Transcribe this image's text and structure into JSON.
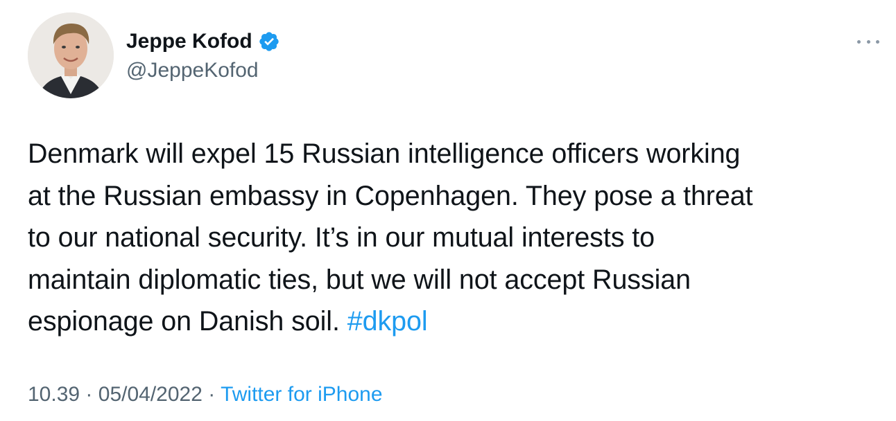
{
  "author": {
    "display_name": "Jeppe Kofod",
    "handle": "@JeppeKofod",
    "verified": true,
    "verified_icon": "verified-badge-icon"
  },
  "tweet": {
    "lines": [
      "Denmark will expel 15 Russian intelligence officers working",
      "at the Russian embassy in Copenhagen. They pose a threat",
      "to our national security. It’s in our mutual interests to",
      "maintain diplomatic ties, but we will not accept Russian",
      "espionage on Danish soil."
    ],
    "hashtag": "#dkpol"
  },
  "meta": {
    "time": "10.39",
    "separator": "·",
    "date": "05/04/2022",
    "source": "Twitter for iPhone"
  },
  "colors": {
    "link": "#1d9bf0",
    "text": "#0f1419",
    "secondary": "#536471"
  },
  "icons": {
    "more": "more-options-icon"
  }
}
